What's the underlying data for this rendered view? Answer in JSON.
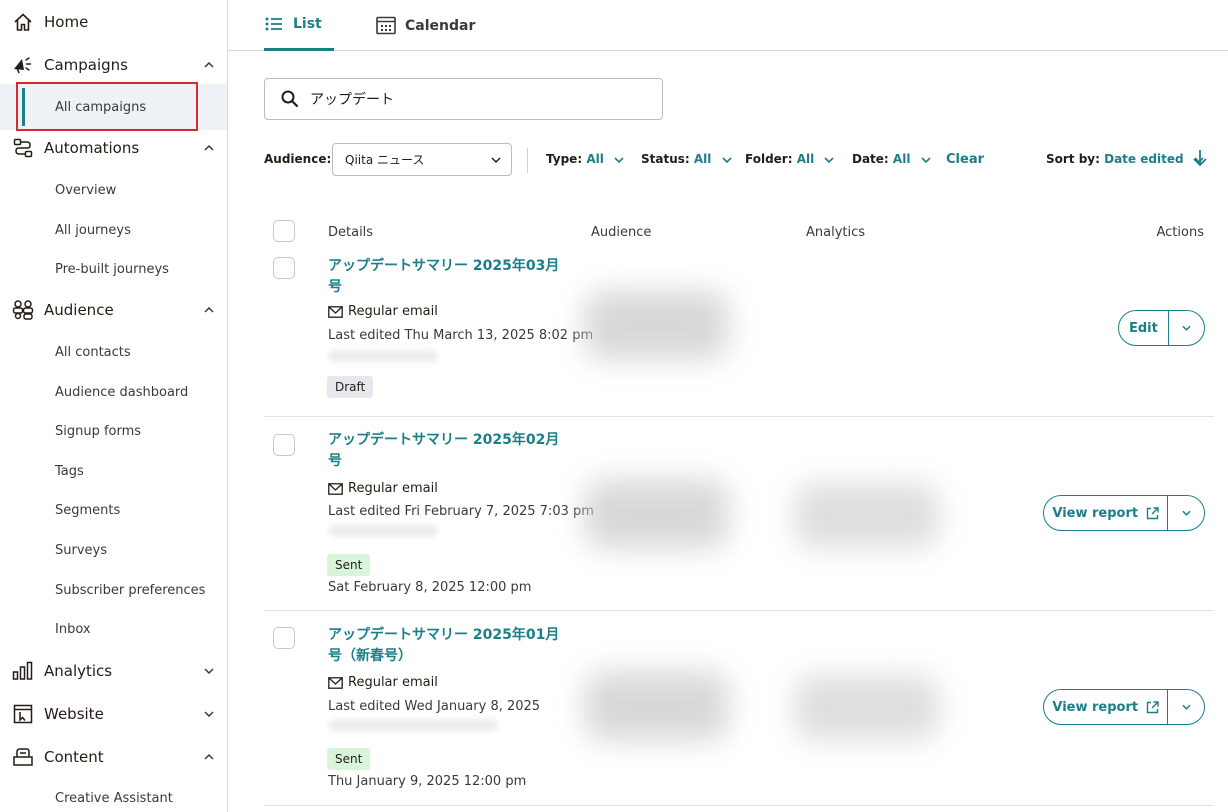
{
  "sidebar": {
    "home": "Home",
    "campaigns": "Campaigns",
    "all_campaigns": "All campaigns",
    "automations": "Automations",
    "overview": "Overview",
    "all_journeys": "All journeys",
    "prebuilt_journeys": "Pre-built journeys",
    "audience": "Audience",
    "all_contacts": "All contacts",
    "audience_dashboard": "Audience dashboard",
    "signup_forms": "Signup forms",
    "tags": "Tags",
    "segments": "Segments",
    "surveys": "Surveys",
    "subscriber_preferences": "Subscriber preferences",
    "inbox": "Inbox",
    "analytics": "Analytics",
    "website": "Website",
    "content": "Content",
    "creative_assistant": "Creative Assistant"
  },
  "tabs": {
    "list": "List",
    "calendar": "Calendar"
  },
  "search": {
    "value": "アップデート"
  },
  "filters": {
    "audience_label": "Audience:",
    "audience_value": "Qiita ニュース",
    "type_label": "Type:",
    "type_value": "All",
    "status_label": "Status:",
    "status_value": "All",
    "folder_label": "Folder:",
    "folder_value": "All",
    "date_label": "Date:",
    "date_value": "All",
    "clear": "Clear",
    "sort_label": "Sort by:",
    "sort_value": "Date edited"
  },
  "table": {
    "headers": {
      "details": "Details",
      "audience": "Audience",
      "analytics": "Analytics",
      "actions": "Actions"
    },
    "rows": [
      {
        "title": "アップデートサマリー 2025年03月号",
        "type": "Regular email",
        "edited": "Last edited Thu March 13, 2025 8:02 pm",
        "status": "Draft",
        "sent_date": "",
        "action": "Edit"
      },
      {
        "title": "アップデートサマリー 2025年02月号",
        "type": "Regular email",
        "edited": "Last edited Fri February 7, 2025 7:03 pm",
        "status": "Sent",
        "sent_date": "Sat February 8, 2025 12:00 pm",
        "action": "View report"
      },
      {
        "title": "アップデートサマリー 2025年01月号（新春号）",
        "type": "Regular email",
        "edited": "Last edited Wed January 8, 2025",
        "status": "Sent",
        "sent_date": "Thu January 9, 2025 12:00 pm",
        "action": "View report"
      }
    ]
  },
  "colors": {
    "accent": "#1b7f8a",
    "highlight": "#d52b2b",
    "sent_badge": "#d8f5dc",
    "draft_badge": "#e5e8ec"
  }
}
